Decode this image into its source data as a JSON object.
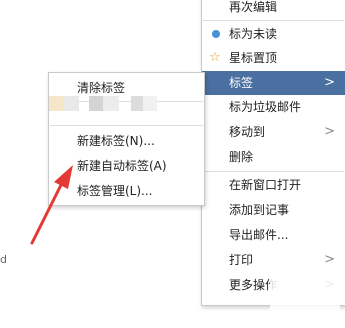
{
  "context_menu": {
    "items": [
      {
        "label": "再次编辑"
      },
      {
        "label": "标为未读"
      },
      {
        "label": "星标置顶"
      },
      {
        "label": "标签"
      },
      {
        "label": "标为垃圾邮件"
      },
      {
        "label": "移动到"
      },
      {
        "label": "删除"
      },
      {
        "label": "在新窗口打开"
      },
      {
        "label": "添加到记事"
      },
      {
        "label": "导出邮件..."
      },
      {
        "label": "打印"
      },
      {
        "label": "更多操作"
      }
    ],
    "submenu_arrow": ">"
  },
  "tag_submenu": {
    "items": [
      {
        "label": "清除标签"
      },
      {
        "label": "新建标签(N)..."
      },
      {
        "label": "新建自动标签(A)"
      },
      {
        "label": "标签管理(L)..."
      }
    ]
  },
  "colors": {
    "highlight": "#4a6fa1",
    "unread_dot": "#4a90d9",
    "star": "#e2a12b",
    "annotation_arrow": "#e53935"
  },
  "background_text": {
    "left_glyph": "d"
  }
}
